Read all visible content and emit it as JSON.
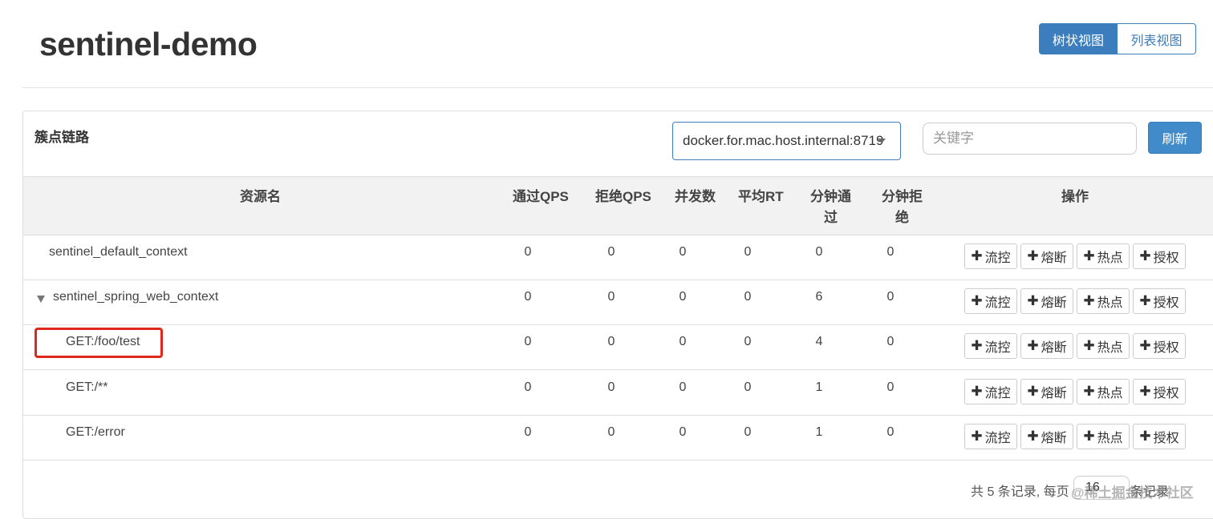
{
  "header": {
    "title": "sentinel-demo",
    "view_tree": "树状视图",
    "view_list": "列表视图"
  },
  "panel": {
    "title": "簇点链路",
    "machine": "docker.for.mac.host.internal:8719",
    "search_placeholder": "关键字",
    "refresh": "刷新"
  },
  "table": {
    "columns": [
      "资源名",
      "通过QPS",
      "拒绝QPS",
      "并发数",
      "平均RT",
      "分钟通\n过",
      "分钟拒\n绝",
      "操作"
    ],
    "col_resource": "资源名",
    "col_pass_qps": "通过QPS",
    "col_block_qps": "拒绝QPS",
    "col_concurrency": "并发数",
    "col_avg_rt": "平均RT",
    "col_min_pass_1": "分钟通",
    "col_min_pass_2": "过",
    "col_min_block_1": "分钟拒",
    "col_min_block_2": "绝",
    "col_ops": "操作",
    "rows": [
      {
        "name": "sentinel_default_context",
        "pass_qps": "0",
        "block_qps": "0",
        "concurrency": "0",
        "avg_rt": "0",
        "min_pass": "0",
        "min_block": "0"
      },
      {
        "name": "sentinel_spring_web_context",
        "pass_qps": "0",
        "block_qps": "0",
        "concurrency": "0",
        "avg_rt": "0",
        "min_pass": "6",
        "min_block": "0"
      },
      {
        "name": "GET:/foo/test",
        "pass_qps": "0",
        "block_qps": "0",
        "concurrency": "0",
        "avg_rt": "0",
        "min_pass": "4",
        "min_block": "0"
      },
      {
        "name": "GET:/**",
        "pass_qps": "0",
        "block_qps": "0",
        "concurrency": "0",
        "avg_rt": "0",
        "min_pass": "1",
        "min_block": "0"
      },
      {
        "name": "GET:/error",
        "pass_qps": "0",
        "block_qps": "0",
        "concurrency": "0",
        "avg_rt": "0",
        "min_pass": "1",
        "min_block": "0"
      }
    ],
    "op_labels": {
      "flow": "流控",
      "degrade": "熔断",
      "hotspot": "热点",
      "auth": "授权"
    }
  },
  "pagination": {
    "summary": "共 5 条记录, 每页",
    "page_size": "16",
    "suffix": "条记录"
  },
  "watermark": "@稀土掘金技术社区",
  "colors": {
    "primary": "#3c7dbd",
    "highlight": "#e0271d"
  }
}
